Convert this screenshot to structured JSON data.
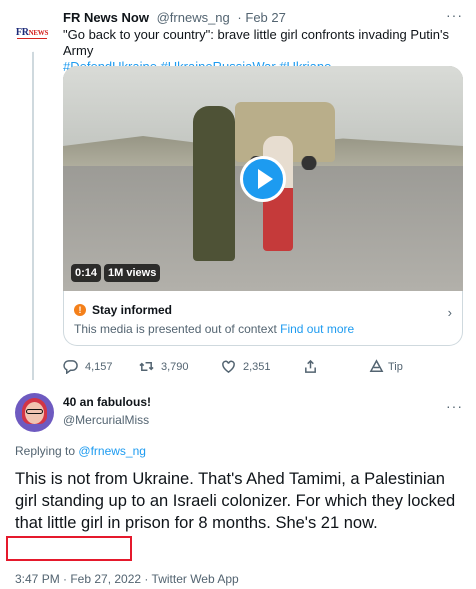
{
  "parent_tweet": {
    "avatar_logo": "FRNews",
    "name": "FR News Now",
    "handle": "@frnews_ng",
    "date": "Feb 27",
    "text": "\"Go back to your country\":  brave little girl confronts invading Putin's Army",
    "hashtags": "#DefendUkraine #UkraineRussiaWar #Ukriane",
    "media": {
      "duration": "0:14",
      "views": "1M views",
      "icon": "play-icon"
    },
    "context_notice": {
      "title": "Stay informed",
      "description": "This media is presented out of context",
      "link": "Find out more",
      "icon": "warning-icon"
    },
    "actions": {
      "replies": "4,157",
      "retweets": "3,790",
      "likes": "2,351",
      "tip": "Tip"
    }
  },
  "reply_tweet": {
    "name": "40 an fabulous!",
    "handle": "@MercurialMiss",
    "replying_prefix": "Replying to",
    "replying_to": "@frnews_ng",
    "text": "This is not from Ukraine. That's Ahed Tamimi, a Palestinian girl standing up to an Israeli colonizer. For which they locked that little girl in prison for 8 months. She's 21 now.",
    "timestamp": "3:47 PM · Feb 27, 2022 · Twitter Web App"
  },
  "colors": {
    "link": "#1d9bf0",
    "secondary_text": "#536471",
    "highlight_box": "#e5192c",
    "warning": "#f4801a"
  }
}
